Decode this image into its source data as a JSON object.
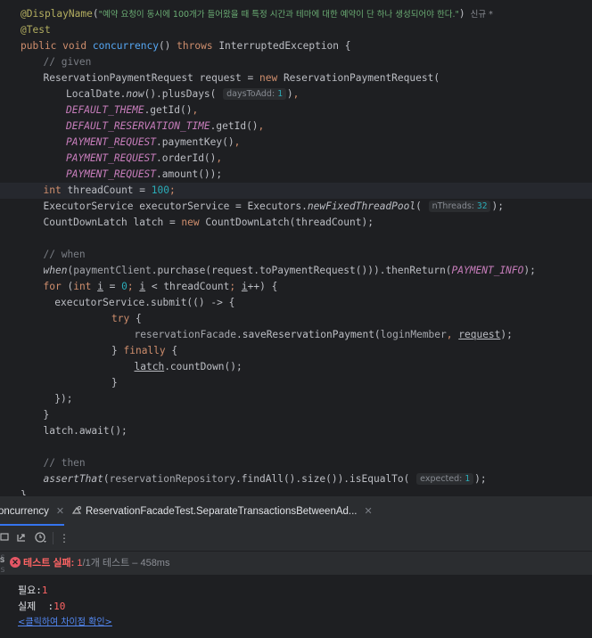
{
  "editor": {
    "lines": [
      {
        "tokens": [
          [
            "anno",
            "@DisplayName"
          ],
          [
            "p",
            "("
          ],
          [
            "str",
            "\"예약 요청이 동시에 100개가 들어왔을 때 특정 시간과 테마에 대한 예약이 단 하나 생성되어야 한다.\""
          ],
          [
            "p",
            ")"
          ]
        ],
        "tag": "신규 *"
      },
      {
        "tokens": [
          [
            "anno",
            "@Test"
          ]
        ]
      },
      {
        "tokens": [
          [
            "kw",
            "public "
          ],
          [
            "kw",
            "void "
          ],
          [
            "fn",
            "concurrency"
          ],
          [
            "p",
            "() "
          ],
          [
            "kw",
            "throws "
          ],
          [
            "p",
            "InterruptedException {"
          ]
        ]
      },
      {
        "indent": 1,
        "tokens": [
          [
            "cmt",
            "// given"
          ]
        ]
      },
      {
        "indent": 1,
        "tokens": [
          [
            "p",
            "ReservationPaymentRequest request = "
          ],
          [
            "kw",
            "new "
          ],
          [
            "p",
            "ReservationPaymentRequest("
          ]
        ]
      },
      {
        "indent": 2,
        "tokens": [
          [
            "p",
            "LocalDate."
          ],
          [
            "ital",
            "now"
          ],
          [
            "p",
            "().plusDays( "
          ],
          [
            "hint",
            "daysToAdd:",
            "1"
          ],
          [
            "p",
            ")"
          ],
          [
            "kw",
            ","
          ]
        ]
      },
      {
        "indent": 2,
        "tokens": [
          [
            "const",
            "DEFAULT_THEME"
          ],
          [
            "p",
            ".getId()"
          ],
          [
            "kw",
            ","
          ]
        ]
      },
      {
        "indent": 2,
        "tokens": [
          [
            "const",
            "DEFAULT_RESERVATION_TIME"
          ],
          [
            "p",
            ".getId()"
          ],
          [
            "kw",
            ","
          ]
        ]
      },
      {
        "indent": 2,
        "tokens": [
          [
            "const",
            "PAYMENT_REQUEST"
          ],
          [
            "p",
            ".paymentKey()"
          ],
          [
            "kw",
            ","
          ]
        ]
      },
      {
        "indent": 2,
        "tokens": [
          [
            "const",
            "PAYMENT_REQUEST"
          ],
          [
            "p",
            ".orderId()"
          ],
          [
            "kw",
            ","
          ]
        ]
      },
      {
        "indent": 2,
        "tokens": [
          [
            "const",
            "PAYMENT_REQUEST"
          ],
          [
            "p",
            ".amount());"
          ]
        ]
      },
      {
        "indent": 1,
        "hl": true,
        "tokens": [
          [
            "kw",
            "int "
          ],
          [
            "p",
            "threadCount = "
          ],
          [
            "num",
            "100"
          ],
          [
            "kw",
            ";"
          ]
        ]
      },
      {
        "indent": 1,
        "tokens": [
          [
            "p",
            "ExecutorService executorService = Executors."
          ],
          [
            "ital",
            "newFixedThreadPool"
          ],
          [
            "p",
            "( "
          ],
          [
            "hint",
            "nThreads:",
            "32"
          ],
          [
            "p",
            ");"
          ]
        ]
      },
      {
        "indent": 1,
        "tokens": [
          [
            "p",
            "CountDownLatch latch = "
          ],
          [
            "kw",
            "new "
          ],
          [
            "p",
            "CountDownLatch(threadCount);"
          ]
        ]
      },
      {
        "tokens": []
      },
      {
        "indent": 1,
        "tokens": [
          [
            "cmt",
            "// when"
          ]
        ]
      },
      {
        "indent": 1,
        "tokens": [
          [
            "ital",
            "when"
          ],
          [
            "p",
            "("
          ],
          [
            "param",
            "paymentClient"
          ],
          [
            "p",
            ".purchase(request.toPaymentRequest())).thenReturn("
          ],
          [
            "const",
            "PAYMENT_INFO"
          ],
          [
            "p",
            ");"
          ]
        ]
      },
      {
        "indent": 1,
        "tokens": [
          [
            "kw",
            "for "
          ],
          [
            "p",
            "("
          ],
          [
            "kw",
            "int "
          ],
          [
            "under",
            "i"
          ],
          [
            "p",
            " = "
          ],
          [
            "num",
            "0"
          ],
          [
            "kw",
            "; "
          ],
          [
            "under",
            "i"
          ],
          [
            "p",
            " < threadCount"
          ],
          [
            "kw",
            "; "
          ],
          [
            "under",
            "i"
          ],
          [
            "p",
            "++) {"
          ]
        ]
      },
      {
        "indent": 2,
        "half": true,
        "tokens": [
          [
            "p",
            "executorService.submit(() -> {"
          ]
        ]
      },
      {
        "indent": 4,
        "tokens": [
          [
            "kw",
            "try "
          ],
          [
            "p",
            "{"
          ]
        ]
      },
      {
        "indent": 5,
        "tokens": [
          [
            "param",
            "reservationFacade"
          ],
          [
            "p",
            ".saveReservationPayment("
          ],
          [
            "param",
            "loginMember"
          ],
          [
            "kw",
            ", "
          ],
          [
            "under",
            "request"
          ],
          [
            "p",
            ");"
          ]
        ]
      },
      {
        "indent": 4,
        "tokens": [
          [
            "p",
            "} "
          ],
          [
            "kw",
            "finally "
          ],
          [
            "p",
            "{"
          ]
        ]
      },
      {
        "indent": 5,
        "tokens": [
          [
            "under",
            "latch"
          ],
          [
            "p",
            ".countDown();"
          ]
        ]
      },
      {
        "indent": 4,
        "tokens": [
          [
            "p",
            "}"
          ]
        ]
      },
      {
        "indent": 2,
        "half": true,
        "tokens": [
          [
            "p",
            "});"
          ]
        ]
      },
      {
        "indent": 1,
        "tokens": [
          [
            "p",
            "}"
          ]
        ]
      },
      {
        "indent": 1,
        "tokens": [
          [
            "p",
            "latch.await();"
          ]
        ]
      },
      {
        "tokens": []
      },
      {
        "indent": 1,
        "tokens": [
          [
            "cmt",
            "// then"
          ]
        ]
      },
      {
        "indent": 1,
        "tokens": [
          [
            "ital",
            "assertThat"
          ],
          [
            "p",
            "("
          ],
          [
            "param",
            "reservationRepository"
          ],
          [
            "p",
            ".findAll().size()).isEqualTo( "
          ],
          [
            "hint",
            "expected:",
            "1"
          ],
          [
            "p",
            ");"
          ]
        ]
      },
      {
        "tokens": [
          [
            "p",
            "}"
          ]
        ]
      }
    ]
  },
  "run_panel": {
    "tabs": [
      {
        "label": "oncurrency",
        "icon": ""
      },
      {
        "label": "ReservationFacadeTest.SeparateTransactionsBetweenAd...",
        "icon": "test-config-icon"
      }
    ],
    "toolbar_icons": [
      "rerun-icon",
      "export-icon",
      "history-icon",
      "more-icon"
    ],
    "status": {
      "label": "테스트 실패:",
      "count": "1",
      "detail": "/1개 테스트 – 458ms",
      "color_fail": "#ff6464"
    },
    "output": {
      "expected_label": "필요:",
      "expected_value": "1",
      "actual_label": "실제  :",
      "actual_value": "10",
      "diff_link": "<클릭하여 차이점 확인>"
    }
  }
}
